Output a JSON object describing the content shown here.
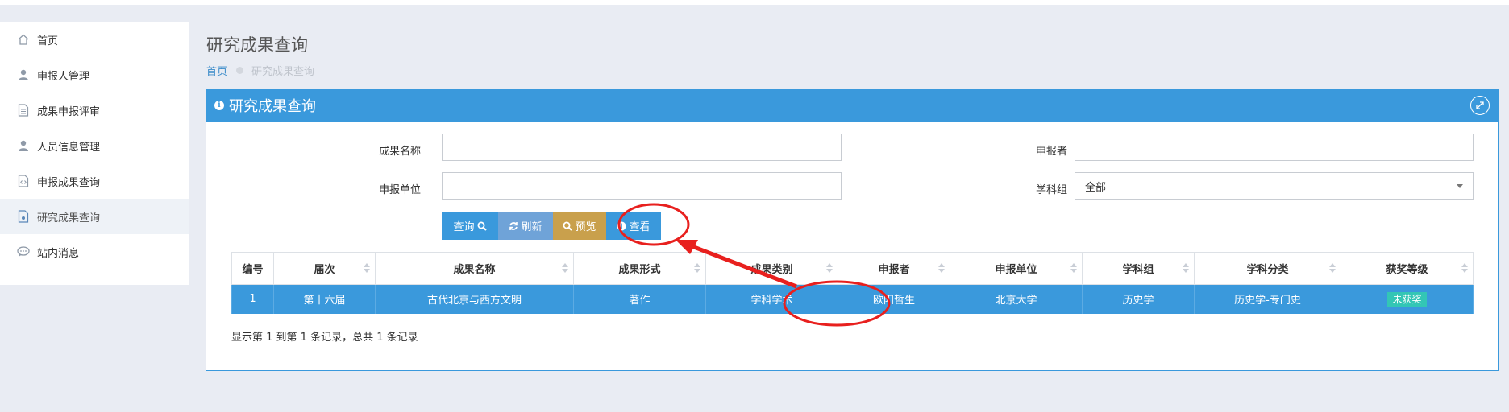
{
  "sidebar": {
    "items": [
      {
        "label": "首页",
        "icon": "home-icon"
      },
      {
        "label": "申报人管理",
        "icon": "user-icon"
      },
      {
        "label": "成果申报评审",
        "icon": "document-icon"
      },
      {
        "label": "人员信息管理",
        "icon": "user-icon"
      },
      {
        "label": "申报成果查询",
        "icon": "code-file-icon"
      },
      {
        "label": "研究成果查询",
        "icon": "file-search-icon"
      },
      {
        "label": "站内消息",
        "icon": "chat-icon"
      }
    ],
    "active_index": 5
  },
  "header": {
    "title": "研究成果查询",
    "breadcrumb": {
      "home": "首页",
      "current": "研究成果查询"
    }
  },
  "panel": {
    "title": "研究成果查询"
  },
  "form": {
    "name_label": "成果名称",
    "name_value": "",
    "applicant_label": "申报者",
    "applicant_value": "",
    "unit_label": "申报单位",
    "unit_value": "",
    "subject_label": "学科组",
    "subject_value": "全部"
  },
  "buttons": {
    "query": "查询",
    "refresh": "刷新",
    "preview": "预览",
    "view": "查看"
  },
  "table": {
    "columns": [
      "编号",
      "届次",
      "成果名称",
      "成果形式",
      "成果类别",
      "申报者",
      "申报单位",
      "学科组",
      "学科分类",
      "获奖等级"
    ],
    "rows": [
      [
        "1",
        "第十六届",
        "古代北京与西方文明",
        "著作",
        "学科学术",
        "欧阳哲生",
        "北京大学",
        "历史学",
        "历史学-专门史",
        "未获奖"
      ]
    ]
  },
  "footer": {
    "info": "显示第 1 到第 1 条记录，总共 1 条记录"
  },
  "colors": {
    "primary": "#3a99dc",
    "preview_btn": "#c9a04c",
    "badge": "#33c6b5",
    "annotation": "#e8201e"
  }
}
